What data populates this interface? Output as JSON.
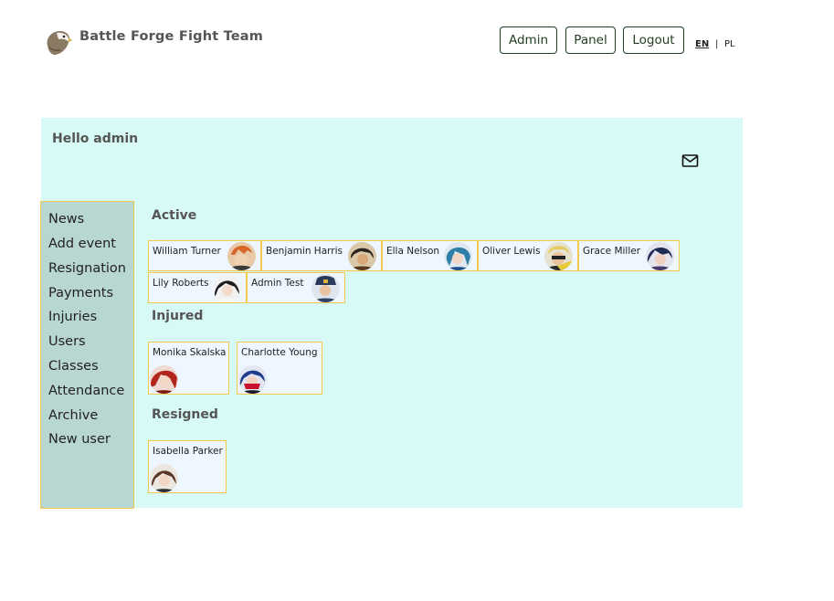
{
  "header": {
    "brand": "Battle Forge Fight Team",
    "buttons": {
      "admin": "Admin",
      "panel": "Panel",
      "logout": "Logout"
    },
    "lang": {
      "en": "EN",
      "separator": "|",
      "pl": "PL",
      "active": "EN"
    }
  },
  "greeting": "Hello admin",
  "sidebar": {
    "items": [
      "News",
      "Add event",
      "Resignation",
      "Payments",
      "Injuries",
      "Users",
      "Classes",
      "Attendance",
      "Archive",
      "New user"
    ]
  },
  "sections": {
    "active": {
      "title": "Active",
      "members": [
        "William Turner",
        "Benjamin Harris",
        "Ella Nelson",
        "Oliver Lewis",
        "Grace Miller",
        "Lily Roberts",
        "Admin Test"
      ]
    },
    "injured": {
      "title": "Injured",
      "members": [
        "Monika Skalska",
        "Charlotte Young"
      ]
    },
    "resigned": {
      "title": "Resigned",
      "members": [
        "Isabella Parker"
      ]
    }
  },
  "icons": {
    "logo": "eagle-logo",
    "mail": "mail-icon"
  },
  "colors": {
    "panel_bg": "#d8faf6",
    "sidebar_bg": "#b8d6d2",
    "card_border": "#f2c94c",
    "card_bg": "#eef6ff",
    "button_border": "#1f3d1f"
  }
}
